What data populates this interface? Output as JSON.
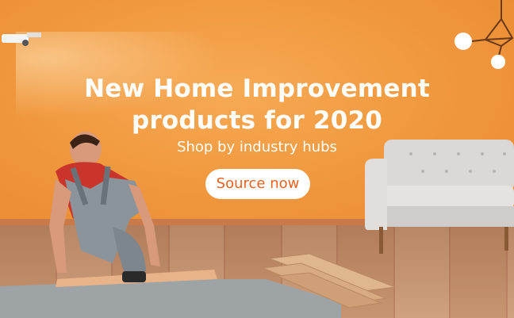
{
  "banner": {
    "headline": "New Home Improvement products for 2020",
    "subheadline": "Shop by industry hubs",
    "cta_label": "Source now"
  },
  "colors": {
    "background": "#f0973d",
    "cta_background": "#ffffff",
    "cta_text": "#e8621f",
    "headline_text": "#ffffff"
  },
  "icons": [
    "security-camera-icon",
    "chandelier-icon",
    "sofa-image",
    "worker-image",
    "wood-planks-image"
  ]
}
